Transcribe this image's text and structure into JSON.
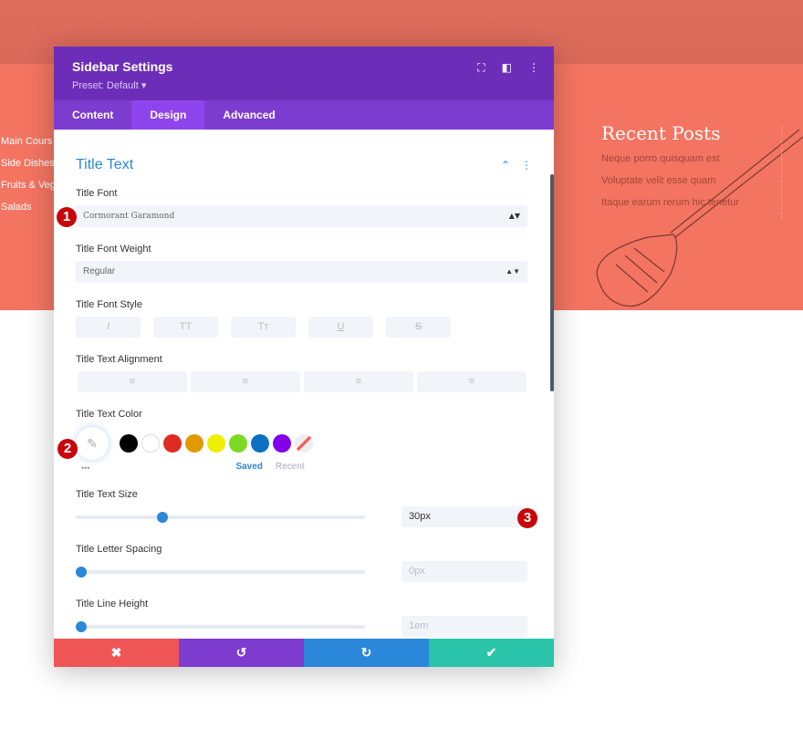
{
  "background": {
    "menu": [
      "Main Cours",
      "Side Dishes",
      "Fruits & Veg",
      "Salads"
    ],
    "recent_title": "Recent Posts",
    "recent_posts": [
      "Neque porro quisquam est",
      "Voluptate velit esse quam",
      "Itaque earum rerum hic tenetur"
    ]
  },
  "modal": {
    "title": "Sidebar Settings",
    "preset": "Preset: Default ▾",
    "tabs": [
      "Content",
      "Design",
      "Advanced"
    ],
    "active_tab": "Design",
    "section_title": "Title Text",
    "title_font": {
      "label": "Title Font",
      "value": "Cormorant Garamond"
    },
    "title_font_weight": {
      "label": "Title Font Weight",
      "value": "Regular"
    },
    "title_font_style": {
      "label": "Title Font Style",
      "options": [
        "I",
        "TT",
        "Tт",
        "U",
        "S"
      ]
    },
    "title_text_alignment": {
      "label": "Title Text Alignment",
      "options": [
        "left",
        "center",
        "right",
        "justify"
      ]
    },
    "title_text_color": {
      "label": "Title Text Color",
      "swatches": [
        "#000000",
        "#ffffff",
        "#e02b20",
        "#e09900",
        "#edf000",
        "#7cda24",
        "#0c71c3",
        "#8300e9"
      ],
      "saved": "Saved",
      "recent": "Recent",
      "more": "•••"
    },
    "title_text_size": {
      "label": "Title Text Size",
      "value": "30px",
      "slider_percent": 30
    },
    "title_letter_spacing": {
      "label": "Title Letter Spacing",
      "value": "0px",
      "slider_percent": 0
    },
    "title_line_height": {
      "label": "Title Line Height",
      "value": "1em",
      "slider_percent": 0
    }
  },
  "footer": {
    "cancel": "✖",
    "undo": "↺",
    "redo": "↻",
    "save": "✔",
    "colors": [
      "#ef5555",
      "#7e3bd0",
      "#2b87da",
      "#29c4a9"
    ]
  },
  "badges": [
    "1",
    "2",
    "3"
  ]
}
